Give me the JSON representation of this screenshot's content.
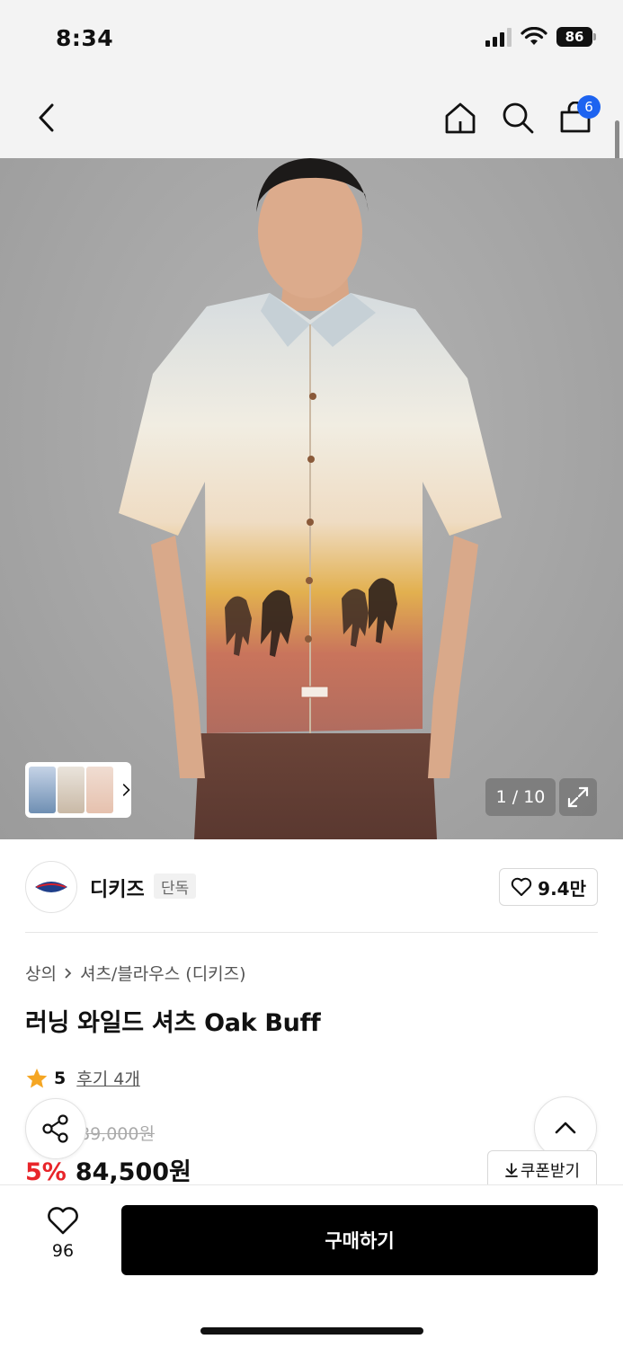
{
  "status_bar": {
    "time": "8:34",
    "battery": "86"
  },
  "nav": {
    "cart_count": "6"
  },
  "gallery": {
    "counter": "1 / 10"
  },
  "brand": {
    "name": "디키즈",
    "tag": "단독",
    "likes": "9.4만"
  },
  "breadcrumb": {
    "category": "상의",
    "subcategory": "셔츠/블라우스 (디키즈)"
  },
  "product": {
    "title": "러닝 와일드 셔츠 Oak Buff",
    "rating": "5",
    "reviews": "후기 4개",
    "original_price": "89,000원",
    "discount": "5%",
    "price": "84,500원"
  },
  "coupon": {
    "label": "쿠폰받기"
  },
  "bottom_bar": {
    "wish_count": "96",
    "buy_label": "구매하기"
  },
  "colors": {
    "accent": "#1d63f0",
    "discount": "#e8252a",
    "star": "#f5a623",
    "buy_bg": "#000000"
  }
}
